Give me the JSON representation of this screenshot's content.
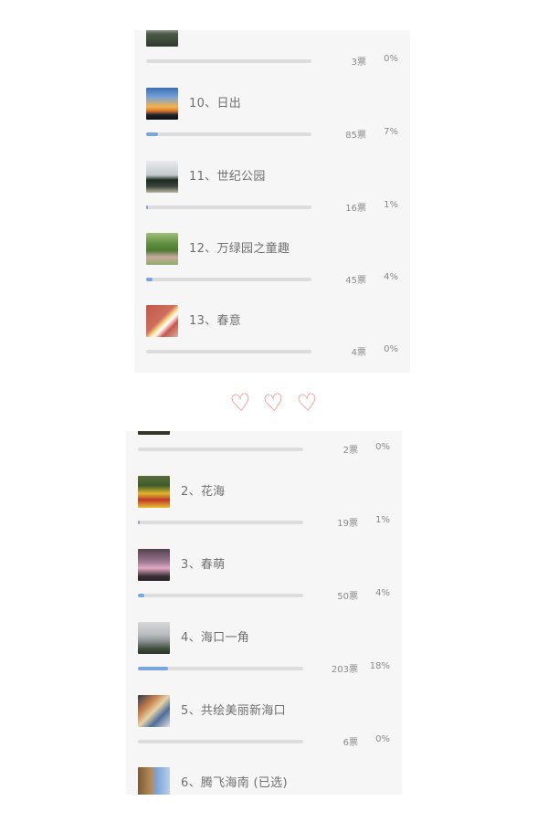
{
  "panel1": {
    "items": [
      {
        "title": "",
        "votes": "3票",
        "pct": "0%",
        "fill": 0.0
      },
      {
        "title": "10、日出",
        "votes": "85票",
        "pct": "7%",
        "fill": 0.07
      },
      {
        "title": "11、世纪公园",
        "votes": "16票",
        "pct": "1%",
        "fill": 0.01
      },
      {
        "title": "12、万绿园之童趣",
        "votes": "45票",
        "pct": "4%",
        "fill": 0.04
      },
      {
        "title": "13、春意",
        "votes": "4票",
        "pct": "0%",
        "fill": 0.0
      }
    ]
  },
  "hearts": {
    "glyph": "♡"
  },
  "panel2": {
    "items": [
      {
        "title": "",
        "votes": "2票",
        "pct": "0%",
        "fill": 0.0
      },
      {
        "title": "2、花海",
        "votes": "19票",
        "pct": "1%",
        "fill": 0.01
      },
      {
        "title": "3、春萌",
        "votes": "50票",
        "pct": "4%",
        "fill": 0.04
      },
      {
        "title": "4、海口一角",
        "votes": "203票",
        "pct": "18%",
        "fill": 0.18
      },
      {
        "title": "5、共绘美丽新海口",
        "votes": "6票",
        "pct": "0%",
        "fill": 0.0
      },
      {
        "title": "6、腾飞海南 (已选)",
        "votes": "",
        "pct": "",
        "fill": 0.0
      }
    ]
  },
  "colors": {
    "bar_fill": "#78a6e0",
    "bar_track": "#dcdcdc",
    "heart": "#f07878",
    "panel_bg": "#f6f6f6"
  }
}
